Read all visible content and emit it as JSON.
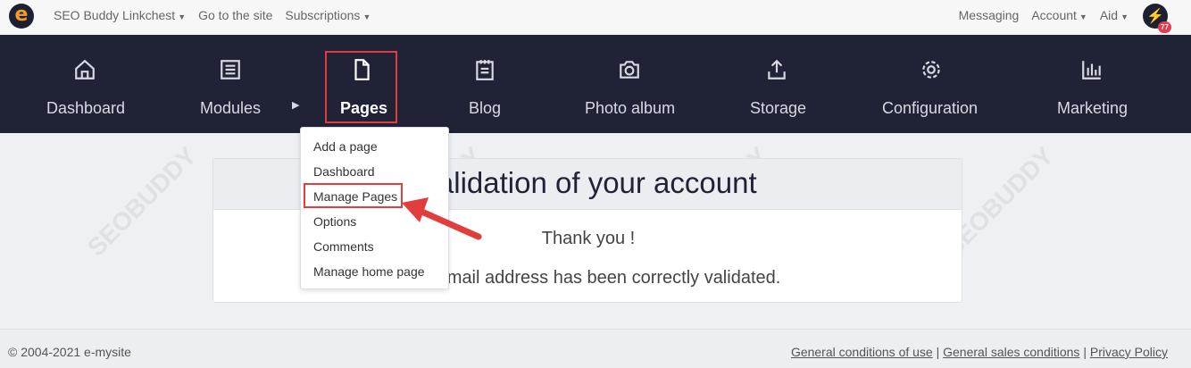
{
  "topbar": {
    "logo_letter": "e",
    "site_menu": "SEO Buddy Linkchest",
    "goto_site": "Go to the site",
    "subscriptions": "Subscriptions",
    "messaging": "Messaging",
    "account": "Account",
    "aid": "Aid",
    "notification_count": "77"
  },
  "nav": {
    "items": [
      {
        "label": "Dashboard",
        "icon": "home-icon"
      },
      {
        "label": "Modules",
        "icon": "list-icon"
      },
      {
        "label": "Pages",
        "icon": "file-icon"
      },
      {
        "label": "Blog",
        "icon": "notepad-icon"
      },
      {
        "label": "Photo album",
        "icon": "camera-icon"
      },
      {
        "label": "Storage",
        "icon": "upload-icon"
      },
      {
        "label": "Configuration",
        "icon": "gear-icon"
      },
      {
        "label": "Marketing",
        "icon": "bar-chart-icon"
      }
    ]
  },
  "dropdown": {
    "items": [
      "Add a page",
      "Dashboard",
      "Manage Pages",
      "Options",
      "Comments",
      "Manage home page"
    ]
  },
  "card": {
    "title": "Validation of your account",
    "line1": "Thank you !",
    "line2": "Your email address has been correctly validated."
  },
  "footer": {
    "copyright": "© 2004-2021 e-mysite",
    "link1": "General conditions of use",
    "link2": "General sales conditions",
    "link3": "Privacy Policy",
    "separator": "|"
  },
  "watermark": "SEOBUDDY",
  "colors": {
    "nav_bg": "#1f2335",
    "accent": "#f39c2b",
    "highlight": "#e23d3d"
  }
}
